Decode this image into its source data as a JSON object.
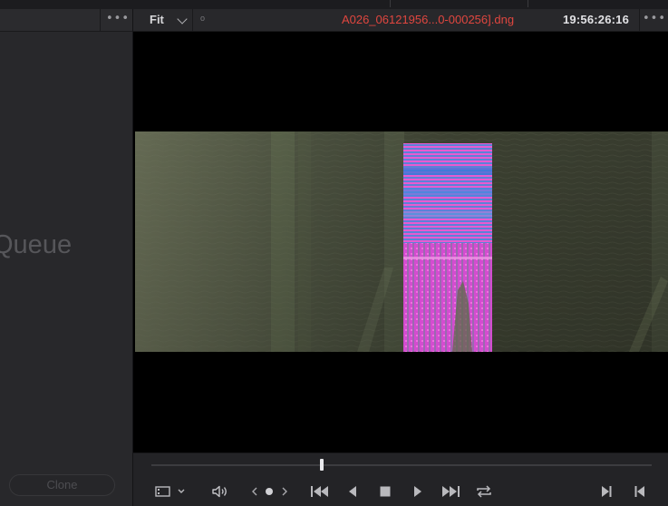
{
  "left_panel": {
    "title": "Queue",
    "clone_label": "Clone",
    "menu_icon": "more-dots-icon"
  },
  "viewer_header": {
    "zoom": "Fit",
    "clip_name": "A026_06121956...0-000256].dng",
    "timecode": "19:56:26:16",
    "menu_icon": "more-dots-icon",
    "mark": "o"
  },
  "transport": {
    "playhead_position": 0.34,
    "buttons": [
      "viewer-mode-icon",
      "volume-icon",
      "jog-left-icon",
      "jog-dot-icon",
      "jog-right-icon",
      "first-frame-icon",
      "play-reverse-icon",
      "stop-icon",
      "play-icon",
      "last-frame-icon",
      "loop-icon",
      "mark-in-icon",
      "mark-out-icon"
    ]
  },
  "colors": {
    "clip_name": "#e0463f",
    "timecode": "#e2e2e5",
    "panel": "#28282b",
    "viewer_bg": "#000000"
  }
}
